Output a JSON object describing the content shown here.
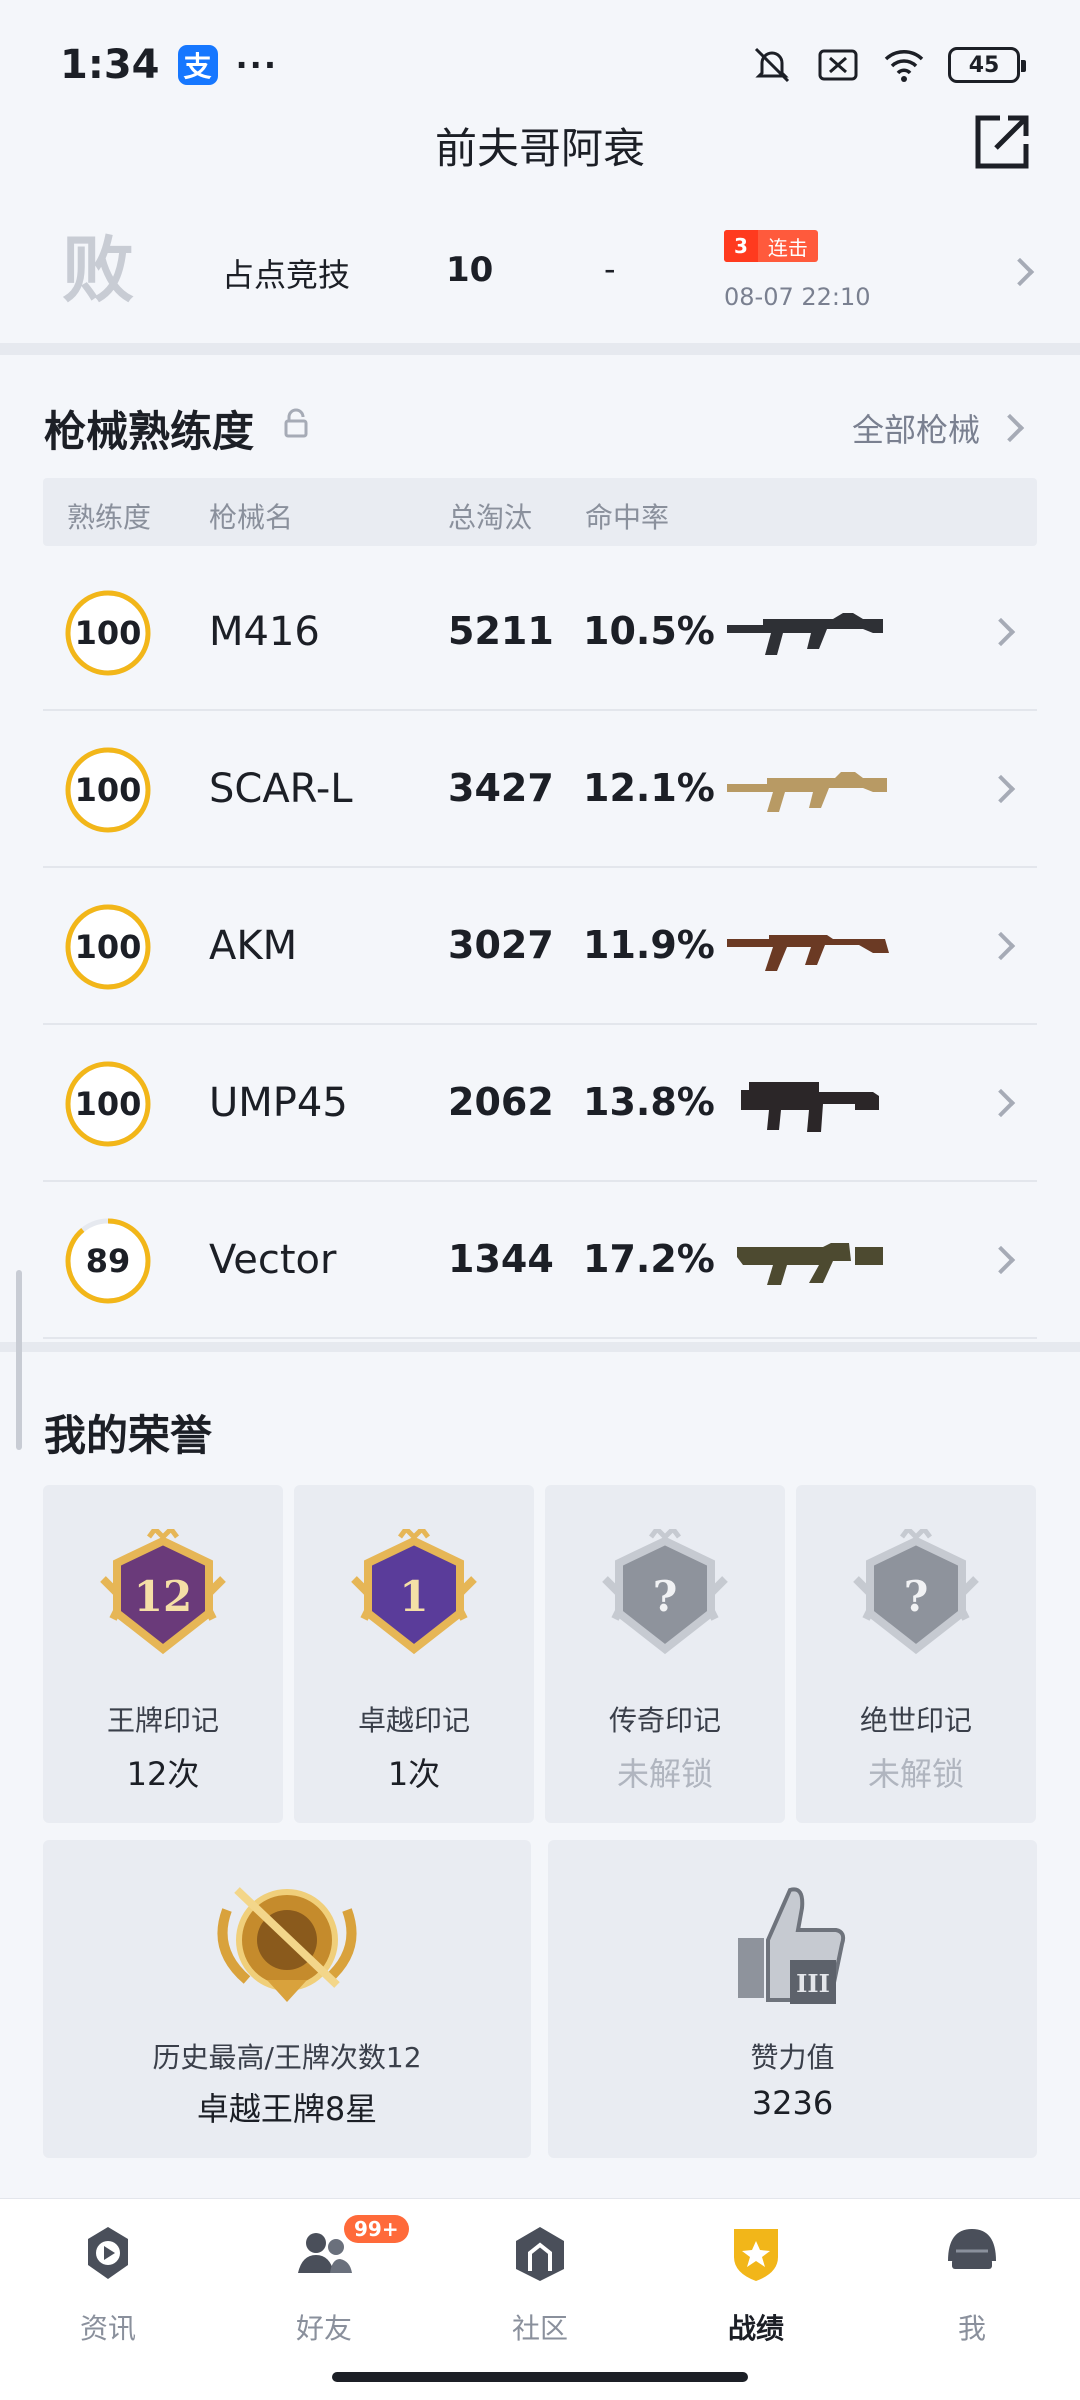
{
  "status_bar": {
    "time": "1:34",
    "app_icon_text": "支",
    "more": "···",
    "battery": "45"
  },
  "header": {
    "title": "前夫哥阿衰"
  },
  "recent_match": {
    "result": "败",
    "mode": "占点竞技",
    "kills": "10",
    "dash": "-",
    "streak_num": "3",
    "streak_label": "连击",
    "time": "08-07 22:10"
  },
  "weapons": {
    "title": "枪械熟练度",
    "all_link": "全部枪械",
    "columns": {
      "mastery": "熟练度",
      "name": "枪械名",
      "kills": "总淘汰",
      "accuracy": "命中率"
    },
    "rows": [
      {
        "mastery": "100",
        "progress": 1.0,
        "name": "M416",
        "kills": "5211",
        "accuracy": "10.5%"
      },
      {
        "mastery": "100",
        "progress": 1.0,
        "name": "SCAR-L",
        "kills": "3427",
        "accuracy": "12.1%"
      },
      {
        "mastery": "100",
        "progress": 1.0,
        "name": "AKM",
        "kills": "3027",
        "accuracy": "11.9%"
      },
      {
        "mastery": "100",
        "progress": 1.0,
        "name": "UMP45",
        "kills": "2062",
        "accuracy": "13.8%"
      },
      {
        "mastery": "89",
        "progress": 0.89,
        "name": "Vector",
        "kills": "1344",
        "accuracy": "17.2%"
      }
    ]
  },
  "honors": {
    "title": "我的荣誉",
    "badges": [
      {
        "label": "王牌印记",
        "value": "12次",
        "badge_num": "12",
        "locked": false
      },
      {
        "label": "卓越印记",
        "value": "1次",
        "badge_num": "1",
        "locked": false
      },
      {
        "label": "传奇印记",
        "value": "未解锁",
        "badge_num": "?",
        "locked": true
      },
      {
        "label": "绝世印记",
        "value": "未解锁",
        "badge_num": "?",
        "locked": true
      }
    ],
    "highest": {
      "label": "历史最高/王牌次数12",
      "value": "卓越王牌8星"
    },
    "likes": {
      "label": "赞力值",
      "value": "3236"
    }
  },
  "bottom_nav": {
    "items": [
      {
        "label": "资讯",
        "active": false
      },
      {
        "label": "好友",
        "active": false,
        "badge": "99+"
      },
      {
        "label": "社区",
        "active": false
      },
      {
        "label": "战绩",
        "active": true
      },
      {
        "label": "我",
        "active": false
      }
    ]
  },
  "colors": {
    "mastery_ring": "#f2b619",
    "streak": "#ff3a1e",
    "nav_active": "#f2b619"
  }
}
